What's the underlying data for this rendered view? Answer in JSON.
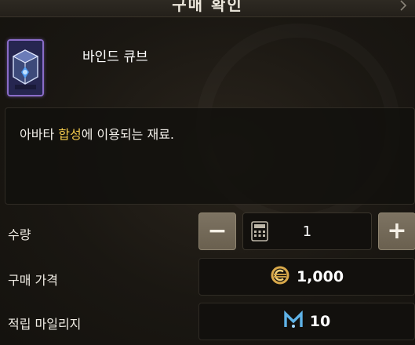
{
  "header": {
    "title": "구매 확인"
  },
  "item": {
    "name": "바인드 큐브",
    "icon": "bind-cube-icon",
    "rarity_color": "#8a6cc8"
  },
  "description": {
    "prefix": "아바타 ",
    "highlight": "합성",
    "suffix": "에 이용되는 재료.",
    "highlight_color": "#f2c94c"
  },
  "quantity": {
    "label": "수량",
    "value": "1",
    "minus_label": "−",
    "plus_label": "+"
  },
  "price": {
    "label": "구매 가격",
    "value": "1,000",
    "currency_icon": "gold-coin-icon"
  },
  "mileage": {
    "label": "적립 마일리지",
    "value": "10",
    "currency_icon": "mileage-m-icon"
  }
}
